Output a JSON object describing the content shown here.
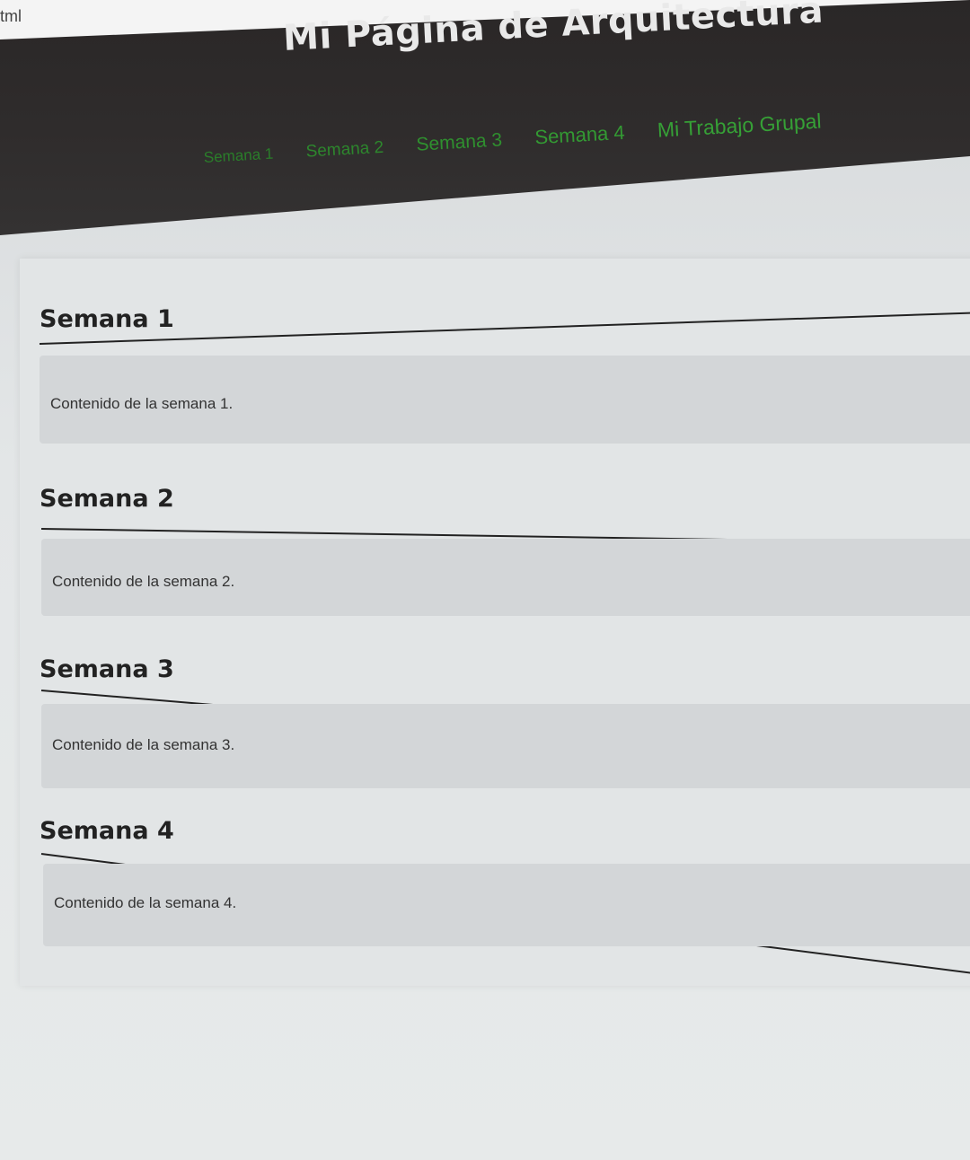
{
  "browser": {
    "tab_fragment": "tml"
  },
  "header": {
    "title": "Mi Página de Arquitectura",
    "nav": [
      "Semana 1",
      "Semana 2",
      "Semana 3",
      "Semana 4",
      "Mi Trabajo Grupal"
    ]
  },
  "sections": [
    {
      "heading": "Semana 1",
      "content": "Contenido de la semana 1."
    },
    {
      "heading": "Semana 2",
      "content": "Contenido de la semana 2."
    },
    {
      "heading": "Semana 3",
      "content": "Contenido de la semana 3."
    },
    {
      "heading": "Semana 4",
      "content": "Contenido de la semana 4."
    }
  ],
  "colors": {
    "header_bg": "#2f2c2c",
    "nav_link": "#2f8f2f",
    "title": "#e9e9e9"
  }
}
